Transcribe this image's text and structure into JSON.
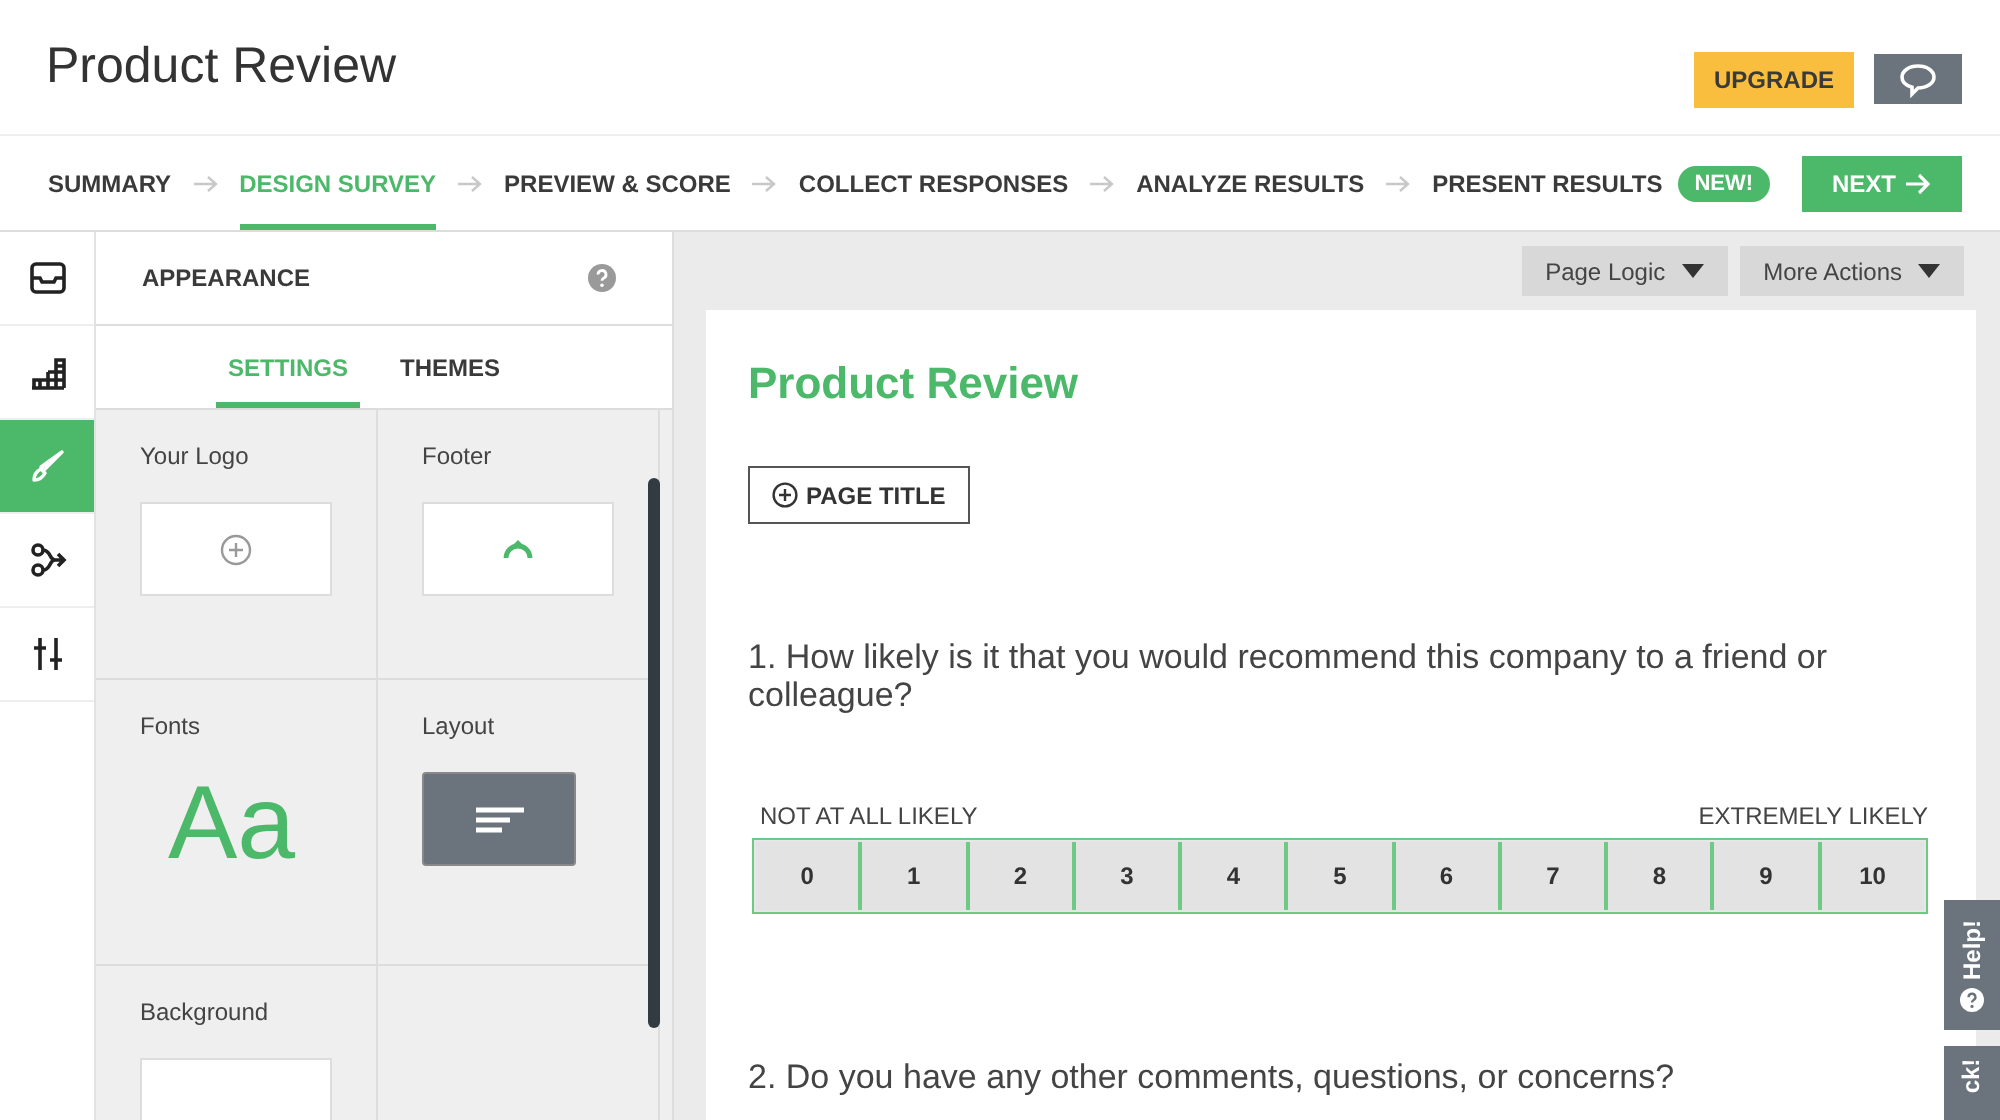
{
  "header": {
    "title": "Product Review",
    "upgrade": "UPGRADE"
  },
  "steps": [
    {
      "label": "SUMMARY",
      "selected": false
    },
    {
      "label": "DESIGN SURVEY",
      "selected": true
    },
    {
      "label": "PREVIEW & SCORE",
      "selected": false
    },
    {
      "label": "COLLECT RESPONSES",
      "selected": false
    },
    {
      "label": "ANALYZE RESULTS",
      "selected": false
    },
    {
      "label": "PRESENT RESULTS",
      "selected": false,
      "badge": "NEW!"
    }
  ],
  "next_button": "NEXT",
  "rail": [
    {
      "kind": "tray",
      "selected": false
    },
    {
      "kind": "blocks",
      "selected": false
    },
    {
      "kind": "brush",
      "selected": true
    },
    {
      "kind": "branch",
      "selected": false
    },
    {
      "kind": "sliders",
      "selected": false
    }
  ],
  "panel": {
    "title": "APPEARANCE",
    "tabs": [
      {
        "label": "SETTINGS",
        "selected": true
      },
      {
        "label": "THEMES",
        "selected": false
      }
    ],
    "cells": [
      {
        "kind": "logo",
        "label": "Your Logo"
      },
      {
        "kind": "footer",
        "label": "Footer"
      },
      {
        "kind": "fonts",
        "label": "Fonts",
        "sample": "Aa"
      },
      {
        "kind": "layout",
        "label": "Layout"
      },
      {
        "kind": "background",
        "label": "Background"
      },
      {
        "kind": "empty"
      }
    ]
  },
  "toolbar": [
    "Page Logic",
    "More Actions"
  ],
  "survey": {
    "title": "Product Review",
    "page_title_button": "PAGE TITLE",
    "questions": [
      {
        "kind": "scale",
        "text": "1. How likely is it that you would recommend this company to a friend or colleague?",
        "low_label": "NOT AT ALL LIKELY",
        "high_label": "EXTREMELY LIKELY",
        "options": [
          "0",
          "1",
          "2",
          "3",
          "4",
          "5",
          "6",
          "7",
          "8",
          "9",
          "10"
        ]
      },
      {
        "kind": "text",
        "text": "2. Do you have any other comments, questions, or concerns?"
      }
    ]
  },
  "side_tabs": [
    {
      "kind": "help",
      "label": "Help!"
    },
    {
      "kind": "plain",
      "label": "ck!"
    }
  ]
}
